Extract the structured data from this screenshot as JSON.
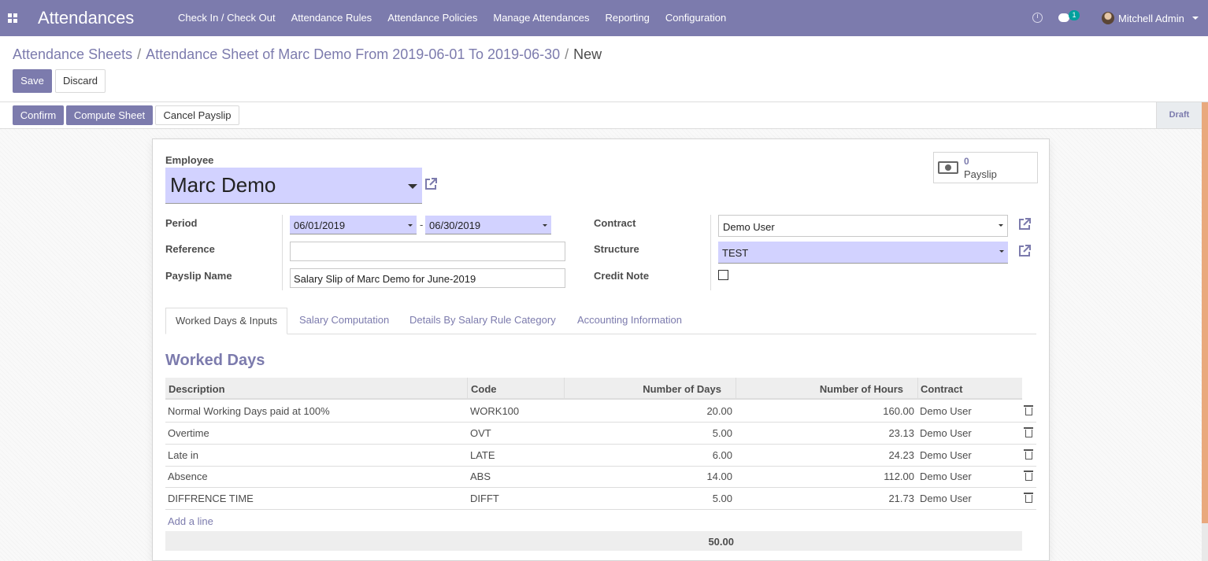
{
  "navbar": {
    "app_title": "Attendances",
    "menu": [
      "Check In / Check Out",
      "Attendance Rules",
      "Attendance Policies",
      "Manage Attendances",
      "Reporting",
      "Configuration"
    ],
    "messages_badge": "1",
    "user_name": "Mitchell Admin"
  },
  "breadcrumb": {
    "items": [
      "Attendance Sheets",
      "Attendance Sheet of Marc Demo From 2019-06-01 To 2019-06-30"
    ],
    "current": "New",
    "separator": "/"
  },
  "actions": {
    "save": "Save",
    "discard": "Discard"
  },
  "header_buttons": {
    "confirm": "Confirm",
    "compute": "Compute Sheet",
    "cancel": "Cancel Payslip"
  },
  "status": "Draft",
  "form": {
    "employee_label": "Employee",
    "employee_value": "Marc Demo",
    "smart_button": {
      "count": "0",
      "label": "Payslip"
    },
    "period_label": "Period",
    "period_from": "06/01/2019",
    "period_sep": "-",
    "period_to": "06/30/2019",
    "reference_label": "Reference",
    "reference_value": "",
    "payslip_name_label": "Payslip Name",
    "payslip_name_value": "Salary Slip of Marc Demo for June-2019",
    "contract_label": "Contract",
    "contract_value": "Demo User",
    "structure_label": "Structure",
    "structure_value": "TEST",
    "credit_note_label": "Credit Note",
    "credit_note_checked": false
  },
  "tabs": [
    "Worked Days & Inputs",
    "Salary Computation",
    "Details By Salary Rule Category",
    "Accounting Information"
  ],
  "worked_days": {
    "title": "Worked Days",
    "columns": [
      "Description",
      "Code",
      "Number of Days",
      "Number of Hours",
      "Contract"
    ],
    "rows": [
      [
        "Normal Working Days paid at 100%",
        "WORK100",
        "20.00",
        "160.00",
        "Demo User"
      ],
      [
        "Overtime",
        "OVT",
        "5.00",
        "23.13",
        "Demo User"
      ],
      [
        "Late in",
        "LATE",
        "6.00",
        "24.23",
        "Demo User"
      ],
      [
        "Absence",
        "ABS",
        "14.00",
        "112.00",
        "Demo User"
      ],
      [
        "DIFFRENCE TIME",
        "DIFFT",
        "5.00",
        "21.73",
        "Demo User"
      ]
    ],
    "add_line": "Add a line",
    "total_days": "50.00"
  },
  "colors": {
    "brand": "#7c7bad",
    "required_field": "#d2d2ff",
    "link": "#7c7bad"
  }
}
